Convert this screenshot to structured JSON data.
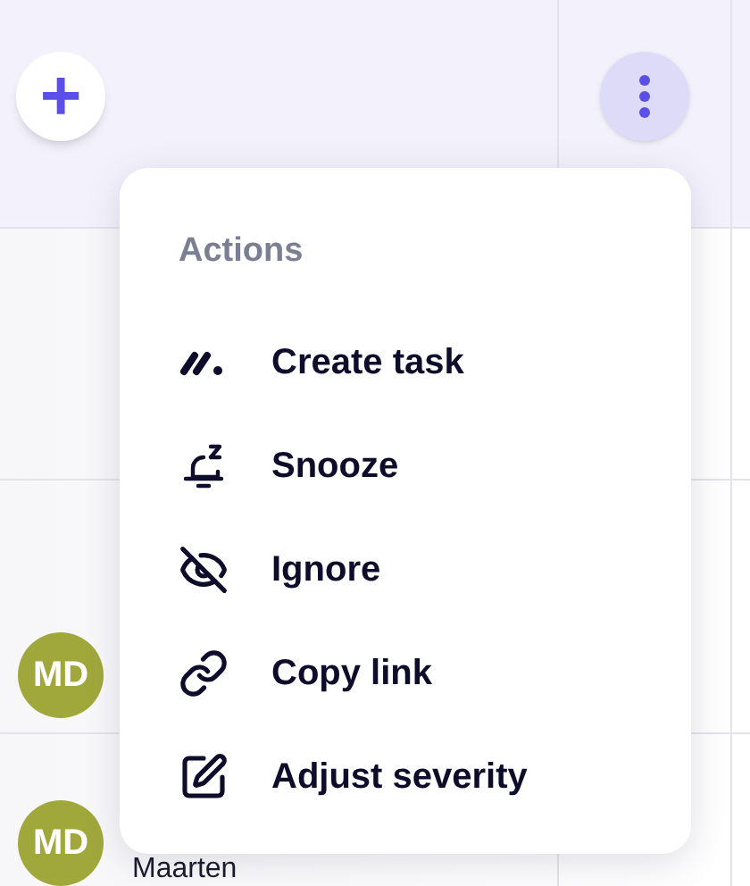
{
  "header": {
    "add_button": "+"
  },
  "rows": [
    {
      "avatar": null
    },
    {
      "avatar": {
        "initials": "MD",
        "color": "#a0a83c"
      }
    },
    {
      "avatar": {
        "initials": "MD",
        "color": "#a0a83c"
      },
      "name": "Maarten"
    }
  ],
  "menu": {
    "heading": "Actions",
    "items": [
      {
        "kind": "task",
        "label": "Create task"
      },
      {
        "kind": "snooze",
        "label": "Snooze"
      },
      {
        "kind": "ignore",
        "label": "Ignore"
      },
      {
        "kind": "link",
        "label": "Copy link"
      },
      {
        "kind": "edit",
        "label": "Adjust severity"
      }
    ]
  }
}
